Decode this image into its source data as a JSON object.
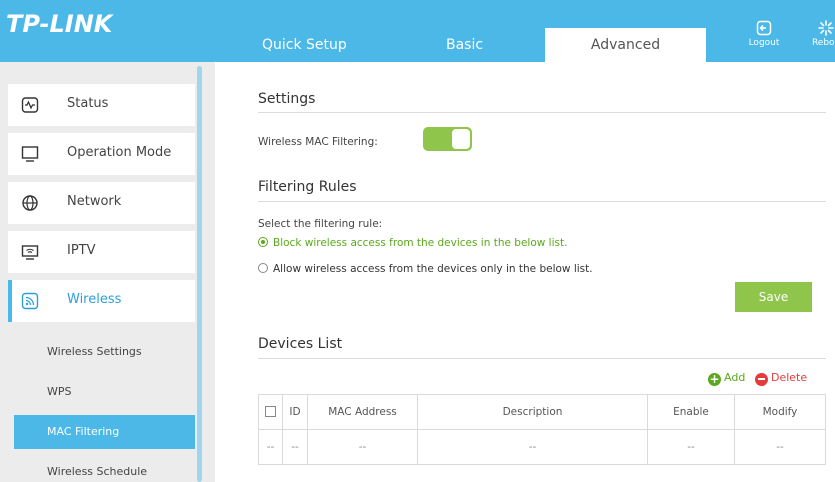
{
  "header": {
    "brand": "TP-LINK",
    "tabs": [
      {
        "label": "Quick Setup"
      },
      {
        "label": "Basic"
      },
      {
        "label": "Advanced"
      }
    ],
    "logout_label": "Logout",
    "reboot_label": "Reboo"
  },
  "sidebar": {
    "items": [
      {
        "label": "Status",
        "icon": "status-icon"
      },
      {
        "label": "Operation Mode",
        "icon": "monitor-icon"
      },
      {
        "label": "Network",
        "icon": "globe-icon"
      },
      {
        "label": "IPTV",
        "icon": "tv-icon"
      },
      {
        "label": "Wireless",
        "icon": "wireless-icon"
      }
    ],
    "sub_items": [
      {
        "label": "Wireless Settings"
      },
      {
        "label": "WPS"
      },
      {
        "label": "MAC Filtering"
      },
      {
        "label": "Wireless Schedule"
      }
    ]
  },
  "main": {
    "settings_title": "Settings",
    "mac_filtering_label": "Wireless MAC Filtering:",
    "mac_filtering_enabled": true,
    "rules_title": "Filtering Rules",
    "select_rule_label": "Select the filtering rule:",
    "rule_block": "Block wireless access from the devices in the below list.",
    "rule_allow": "Allow wireless access from the devices only in the below list.",
    "save_label": "Save",
    "devices_title": "Devices List",
    "add_label": "Add",
    "delete_label": "Delete",
    "table": {
      "columns": [
        "ID",
        "MAC Address",
        "Description",
        "Enable",
        "Modify"
      ],
      "rows": [
        [
          "--",
          "--",
          "--",
          "--",
          "--",
          "--"
        ]
      ]
    }
  },
  "colors": {
    "accent_blue": "#4cb8e8",
    "accent_green": "#8fc54a",
    "delete_red": "#e53b3b"
  }
}
